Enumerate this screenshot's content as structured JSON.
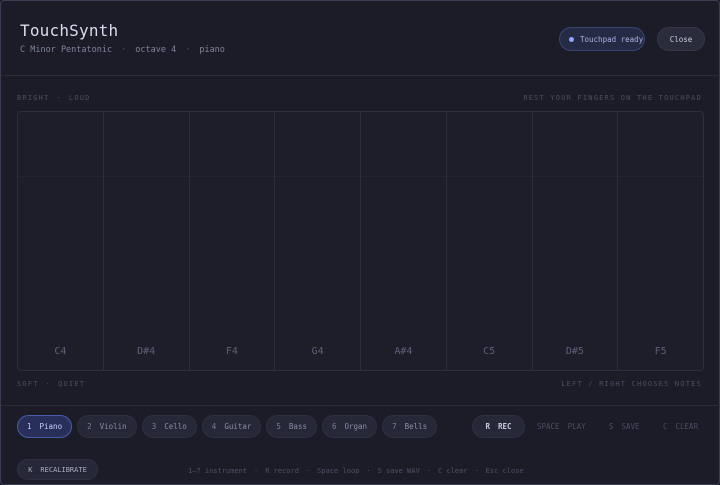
{
  "header": {
    "title": "TouchSynth",
    "scale": "C Minor Pentatonic",
    "octave": "octave 4",
    "instrument": "piano",
    "separator": "·",
    "status": "Touchpad ready",
    "close_label": "Close"
  },
  "pad": {
    "top_left_a": "BRIGHT",
    "top_left_b": "LOUD",
    "top_right": "REST YOUR FINGERS ON THE TOUCHPAD",
    "bottom_left_a": "SOFT",
    "bottom_left_b": "QUIET",
    "bottom_right": "LEFT / RIGHT CHOOSES NOTES",
    "keys": [
      "C4",
      "D#4",
      "F4",
      "G4",
      "A#4",
      "C5",
      "D#5",
      "F5"
    ]
  },
  "instruments": [
    {
      "key": "1",
      "label": "Piano",
      "active": true
    },
    {
      "key": "2",
      "label": "Violin",
      "active": false
    },
    {
      "key": "3",
      "label": "Cello",
      "active": false
    },
    {
      "key": "4",
      "label": "Guitar",
      "active": false
    },
    {
      "key": "5",
      "label": "Bass",
      "active": false
    },
    {
      "key": "6",
      "label": "Organ",
      "active": false
    },
    {
      "key": "7",
      "label": "Bells",
      "active": false
    }
  ],
  "controls": {
    "rec_key": "R",
    "rec_label": "REC",
    "play_key": "SPACE",
    "play_label": "PLAY",
    "save_key": "S",
    "save_label": "SAVE",
    "clear_key": "C",
    "clear_label": "CLEAR",
    "recal_key": "K",
    "recal_label": "RECALIBRATE"
  },
  "shortcuts": [
    "1–7 instrument",
    "R record",
    "Space loop",
    "S save WAV",
    "C clear",
    "Esc close"
  ],
  "colors": {
    "background": "#1b1c27",
    "accent": "#8ea6ff",
    "active_pill": "#283059"
  }
}
